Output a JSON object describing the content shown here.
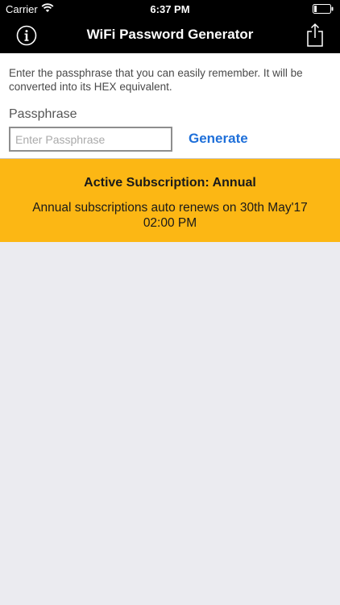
{
  "status": {
    "carrier": "Carrier",
    "time": "6:37 PM"
  },
  "nav": {
    "title": "WiFi Password Generator"
  },
  "form": {
    "instructions": "Enter the passphrase that you can easily remember. It will be converted into its HEX equivalent.",
    "passphrase_label": "Passphrase",
    "passphrase_placeholder": "Enter Passphrase",
    "passphrase_value": "",
    "generate_label": "Generate"
  },
  "subscription": {
    "title": "Active Subscription: Annual",
    "text": "Annual subscriptions auto renews on 30th May'17 02:00 PM"
  },
  "colors": {
    "header": "#000000",
    "accent": "#1e6fd9",
    "subscription_bg": "#fcb714",
    "background": "#ebebf0"
  },
  "icons": [
    "wifi-icon",
    "battery-icon",
    "info-icon",
    "share-icon"
  ]
}
